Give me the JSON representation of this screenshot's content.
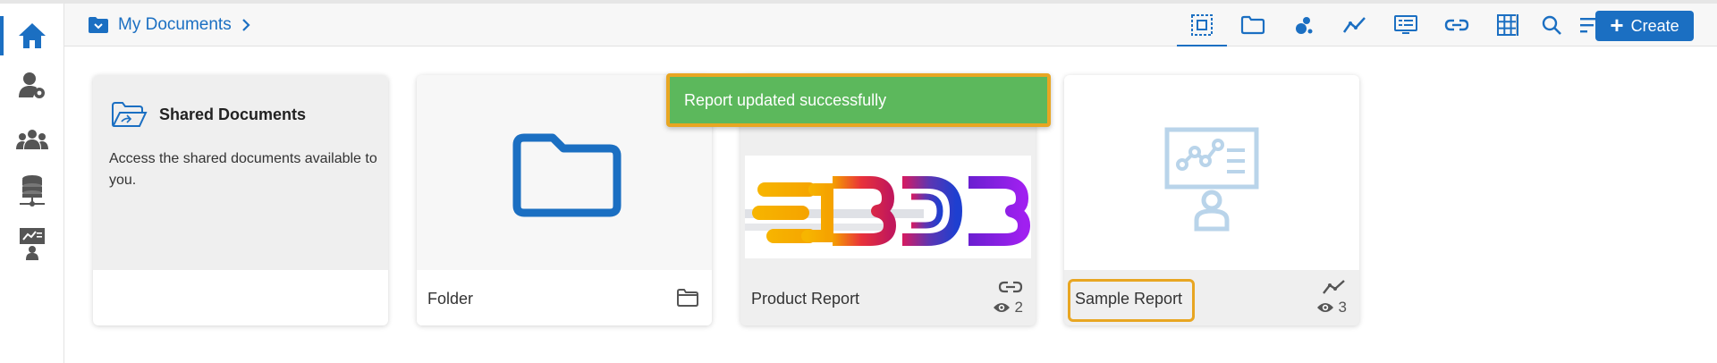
{
  "breadcrumb": {
    "label": "My Documents"
  },
  "toolbar": {
    "create_label": "Create",
    "accent_color": "#1b6fc2",
    "icons": [
      "select-all-icon",
      "folder-icon",
      "bubble-chart-icon",
      "line-chart-icon",
      "presentation-icon",
      "link-icon",
      "grid-icon",
      "search-icon",
      "sort-icon"
    ]
  },
  "sidenav": {
    "items": [
      "home-icon",
      "user-settings-icon",
      "users-group-icon",
      "database-network-icon",
      "presenter-icon"
    ]
  },
  "cards": {
    "shared": {
      "title": "Shared Documents",
      "description": "Access the shared documents available to you."
    },
    "folder": {
      "label": "Folder"
    },
    "product": {
      "label": "Product Report",
      "views": "2"
    },
    "sample": {
      "label": "Sample Report",
      "views": "3"
    }
  },
  "toast": {
    "message": "Report updated successfully",
    "color": "#5cb85c"
  },
  "highlight_color": "#e8a622"
}
